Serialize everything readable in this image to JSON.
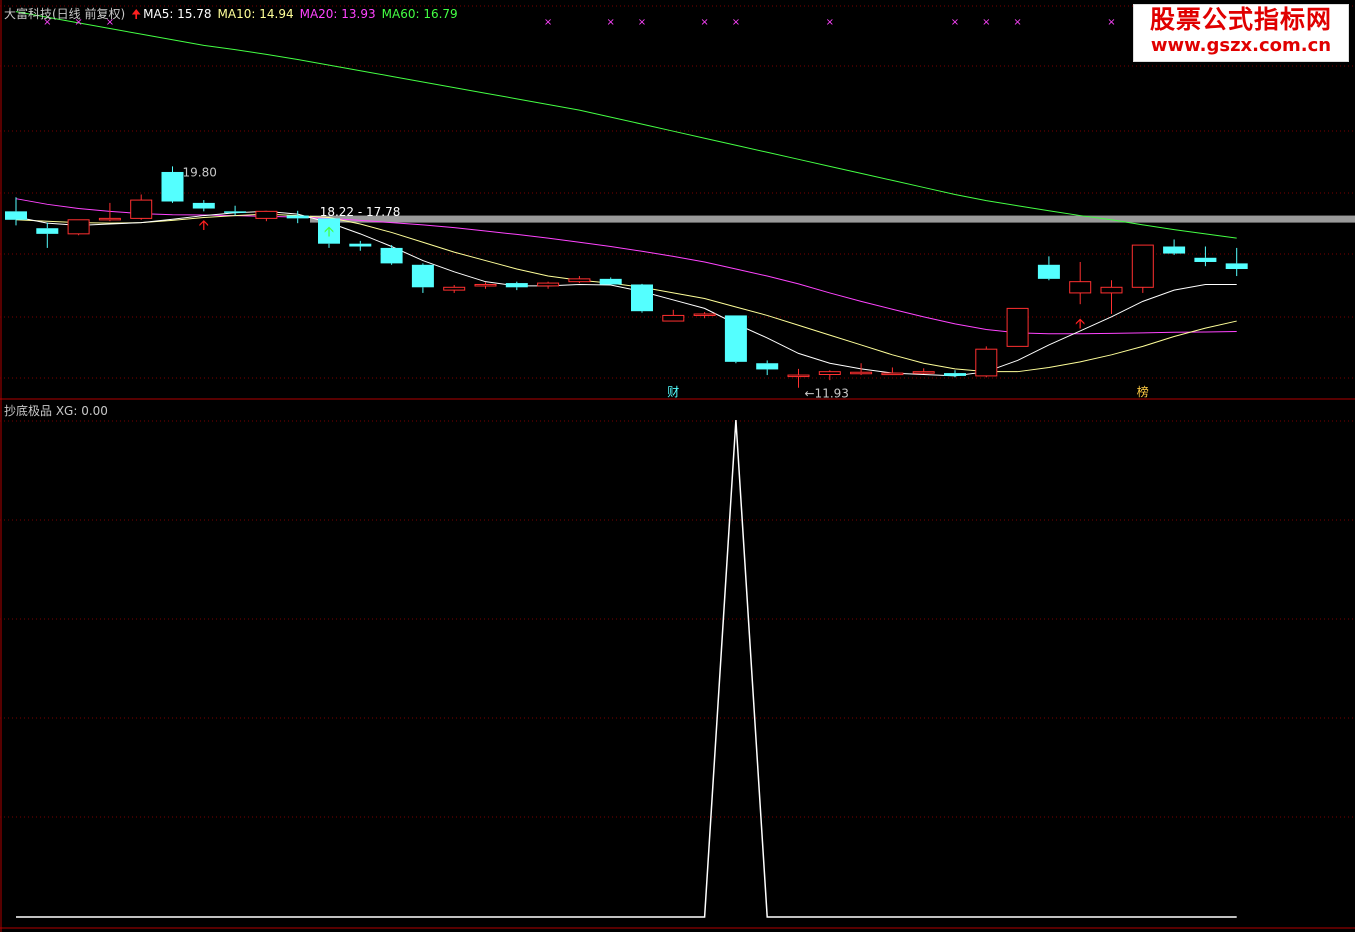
{
  "header": {
    "stock_name": "大富科技(日线 前复权)",
    "ma5": "MA5: 15.78",
    "ma10": "MA10: 14.94",
    "ma20": "MA20: 13.93",
    "ma60": "MA60: 16.79",
    "colors": {
      "stock_name": "#c8c8c8",
      "ma5": "#ffffff",
      "ma10": "#ffff99",
      "ma20": "#ff44ff",
      "ma60": "#44ff44",
      "up_arrow": "#ff2020"
    }
  },
  "indicator_header": "抄底极品  XG: 0.00",
  "watermark": {
    "line1": "股票公式指标网",
    "line2": "www.gszx.com.cn"
  },
  "chart_data": [
    {
      "type": "candlestick",
      "up_color": "#ff3030",
      "down_color": "#54ffff",
      "candles": [
        {
          "o": 18.2,
          "h": 18.7,
          "l": 17.7,
          "c": 17.9
        },
        {
          "o": 17.6,
          "h": 17.8,
          "l": 16.9,
          "c": 17.4
        },
        {
          "o": 17.4,
          "h": 17.9,
          "l": 17.35,
          "c": 17.9
        },
        {
          "o": 17.9,
          "h": 18.5,
          "l": 17.85,
          "c": 17.95
        },
        {
          "o": 17.95,
          "h": 18.8,
          "l": 17.9,
          "c": 18.6
        },
        {
          "o": 19.6,
          "h": 19.8,
          "l": 18.5,
          "c": 18.55
        },
        {
          "o": 18.5,
          "h": 18.6,
          "l": 18.2,
          "c": 18.3
        },
        {
          "o": 18.2,
          "h": 18.4,
          "l": 18.05,
          "c": 18.15
        },
        {
          "o": 17.95,
          "h": 18.2,
          "l": 17.85,
          "c": 18.2
        },
        {
          "o": 18.05,
          "h": 18.22,
          "l": 17.78,
          "c": 17.95
        },
        {
          "o": 17.95,
          "h": 17.95,
          "l": 16.9,
          "c": 17.05
        },
        {
          "o": 17.05,
          "h": 17.15,
          "l": 16.8,
          "c": 16.95
        },
        {
          "o": 16.9,
          "h": 17.0,
          "l": 16.3,
          "c": 16.35
        },
        {
          "o": 16.3,
          "h": 16.35,
          "l": 15.3,
          "c": 15.5
        },
        {
          "o": 15.4,
          "h": 15.58,
          "l": 15.3,
          "c": 15.5
        },
        {
          "o": 15.55,
          "h": 15.68,
          "l": 15.45,
          "c": 15.6
        },
        {
          "o": 15.65,
          "h": 15.7,
          "l": 15.4,
          "c": 15.5
        },
        {
          "o": 15.55,
          "h": 15.7,
          "l": 15.45,
          "c": 15.65
        },
        {
          "o": 15.7,
          "h": 15.9,
          "l": 15.65,
          "c": 15.8
        },
        {
          "o": 15.8,
          "h": 15.85,
          "l": 15.6,
          "c": 15.6
        },
        {
          "o": 15.6,
          "h": 15.62,
          "l": 14.6,
          "c": 14.65
        },
        {
          "o": 14.3,
          "h": 14.7,
          "l": 14.3,
          "c": 14.5
        },
        {
          "o": 14.5,
          "h": 14.62,
          "l": 14.4,
          "c": 14.55
        },
        {
          "o": 14.5,
          "h": 14.5,
          "l": 12.8,
          "c": 12.85
        },
        {
          "o": 12.8,
          "h": 12.9,
          "l": 12.38,
          "c": 12.58
        },
        {
          "o": 12.38,
          "h": 12.6,
          "l": 11.93,
          "c": 12.38
        },
        {
          "o": 12.4,
          "h": 12.55,
          "l": 12.2,
          "c": 12.5
        },
        {
          "o": 12.48,
          "h": 12.8,
          "l": 12.38,
          "c": 12.48
        },
        {
          "o": 12.45,
          "h": 12.65,
          "l": 12.38,
          "c": 12.45
        },
        {
          "o": 12.5,
          "h": 12.62,
          "l": 12.42,
          "c": 12.5
        },
        {
          "o": 12.45,
          "h": 12.55,
          "l": 12.3,
          "c": 12.35
        },
        {
          "o": 12.35,
          "h": 13.4,
          "l": 12.3,
          "c": 13.3
        },
        {
          "o": 13.4,
          "h": 14.75,
          "l": 13.4,
          "c": 14.75
        },
        {
          "o": 16.3,
          "h": 16.6,
          "l": 15.75,
          "c": 15.8
        },
        {
          "o": 15.3,
          "h": 16.4,
          "l": 14.9,
          "c": 15.7
        },
        {
          "o": 15.3,
          "h": 15.75,
          "l": 14.55,
          "c": 15.5
        },
        {
          "o": 15.5,
          "h": 17.0,
          "l": 15.3,
          "c": 17.0
        },
        {
          "o": 16.95,
          "h": 17.2,
          "l": 16.65,
          "c": 16.7
        },
        {
          "o": 16.55,
          "h": 16.95,
          "l": 16.25,
          "c": 16.4
        },
        {
          "o": 16.35,
          "h": 16.9,
          "l": 15.9,
          "c": 16.15
        }
      ],
      "ma5": [
        18.0,
        17.78,
        17.7,
        17.75,
        17.8,
        17.92,
        18.05,
        18.15,
        18.2,
        18.1,
        17.8,
        17.4,
        16.95,
        16.45,
        16.05,
        15.7,
        15.55,
        15.55,
        15.6,
        15.58,
        15.35,
        15.05,
        14.75,
        14.2,
        13.7,
        13.15,
        12.8,
        12.6,
        12.45,
        12.4,
        12.35,
        12.5,
        12.9,
        13.45,
        13.95,
        14.45,
        15.0,
        15.4,
        15.6,
        15.6
      ],
      "ma10": [
        17.9,
        17.85,
        17.8,
        17.78,
        17.8,
        17.88,
        17.98,
        18.05,
        18.1,
        18.05,
        17.98,
        17.75,
        17.45,
        17.1,
        16.75,
        16.45,
        16.15,
        15.9,
        15.75,
        15.65,
        15.5,
        15.3,
        15.1,
        14.8,
        14.5,
        14.15,
        13.8,
        13.45,
        13.1,
        12.8,
        12.6,
        12.5,
        12.5,
        12.65,
        12.85,
        13.1,
        13.4,
        13.75,
        14.05,
        14.3
      ],
      "ma20": [
        18.65,
        18.45,
        18.3,
        18.2,
        18.12,
        18.08,
        18.07,
        18.05,
        18.02,
        18.0,
        17.95,
        17.88,
        17.8,
        17.72,
        17.62,
        17.5,
        17.38,
        17.25,
        17.1,
        16.95,
        16.78,
        16.6,
        16.4,
        16.15,
        15.9,
        15.62,
        15.3,
        15.0,
        14.72,
        14.45,
        14.2,
        14.0,
        13.88,
        13.85,
        13.85,
        13.86,
        13.88,
        13.9,
        13.91,
        13.93
      ],
      "ma60": [
        25.3,
        25.1,
        24.9,
        24.7,
        24.5,
        24.3,
        24.1,
        23.95,
        23.78,
        23.6,
        23.4,
        23.2,
        23.0,
        22.8,
        22.6,
        22.4,
        22.2,
        22.0,
        21.8,
        21.55,
        21.3,
        21.05,
        20.8,
        20.55,
        20.3,
        20.05,
        19.8,
        19.55,
        19.3,
        19.05,
        18.8,
        18.58,
        18.4,
        18.22,
        18.05,
        17.9,
        17.72,
        17.55,
        17.4,
        17.25
      ],
      "band": [
        17.8,
        18.05
      ],
      "annotations": {
        "high_label": "19.80",
        "low_label": "11.93",
        "band_label": "18.22 - 17.78",
        "marker_cai": "财",
        "marker_bang": "榜"
      },
      "ylim": [
        11.6,
        25.5
      ],
      "grid": true
    },
    {
      "type": "line",
      "name": "XG",
      "values": [
        0,
        0,
        0,
        0,
        0,
        0,
        0,
        0,
        0,
        0,
        0,
        0,
        0,
        0,
        0,
        0,
        0,
        0,
        0,
        0,
        0,
        0,
        0,
        1,
        0,
        0,
        0,
        0,
        0,
        0,
        0,
        0,
        0,
        0,
        0,
        0,
        0,
        0,
        0,
        0
      ],
      "ylim": [
        0,
        1
      ],
      "grid": true
    }
  ]
}
